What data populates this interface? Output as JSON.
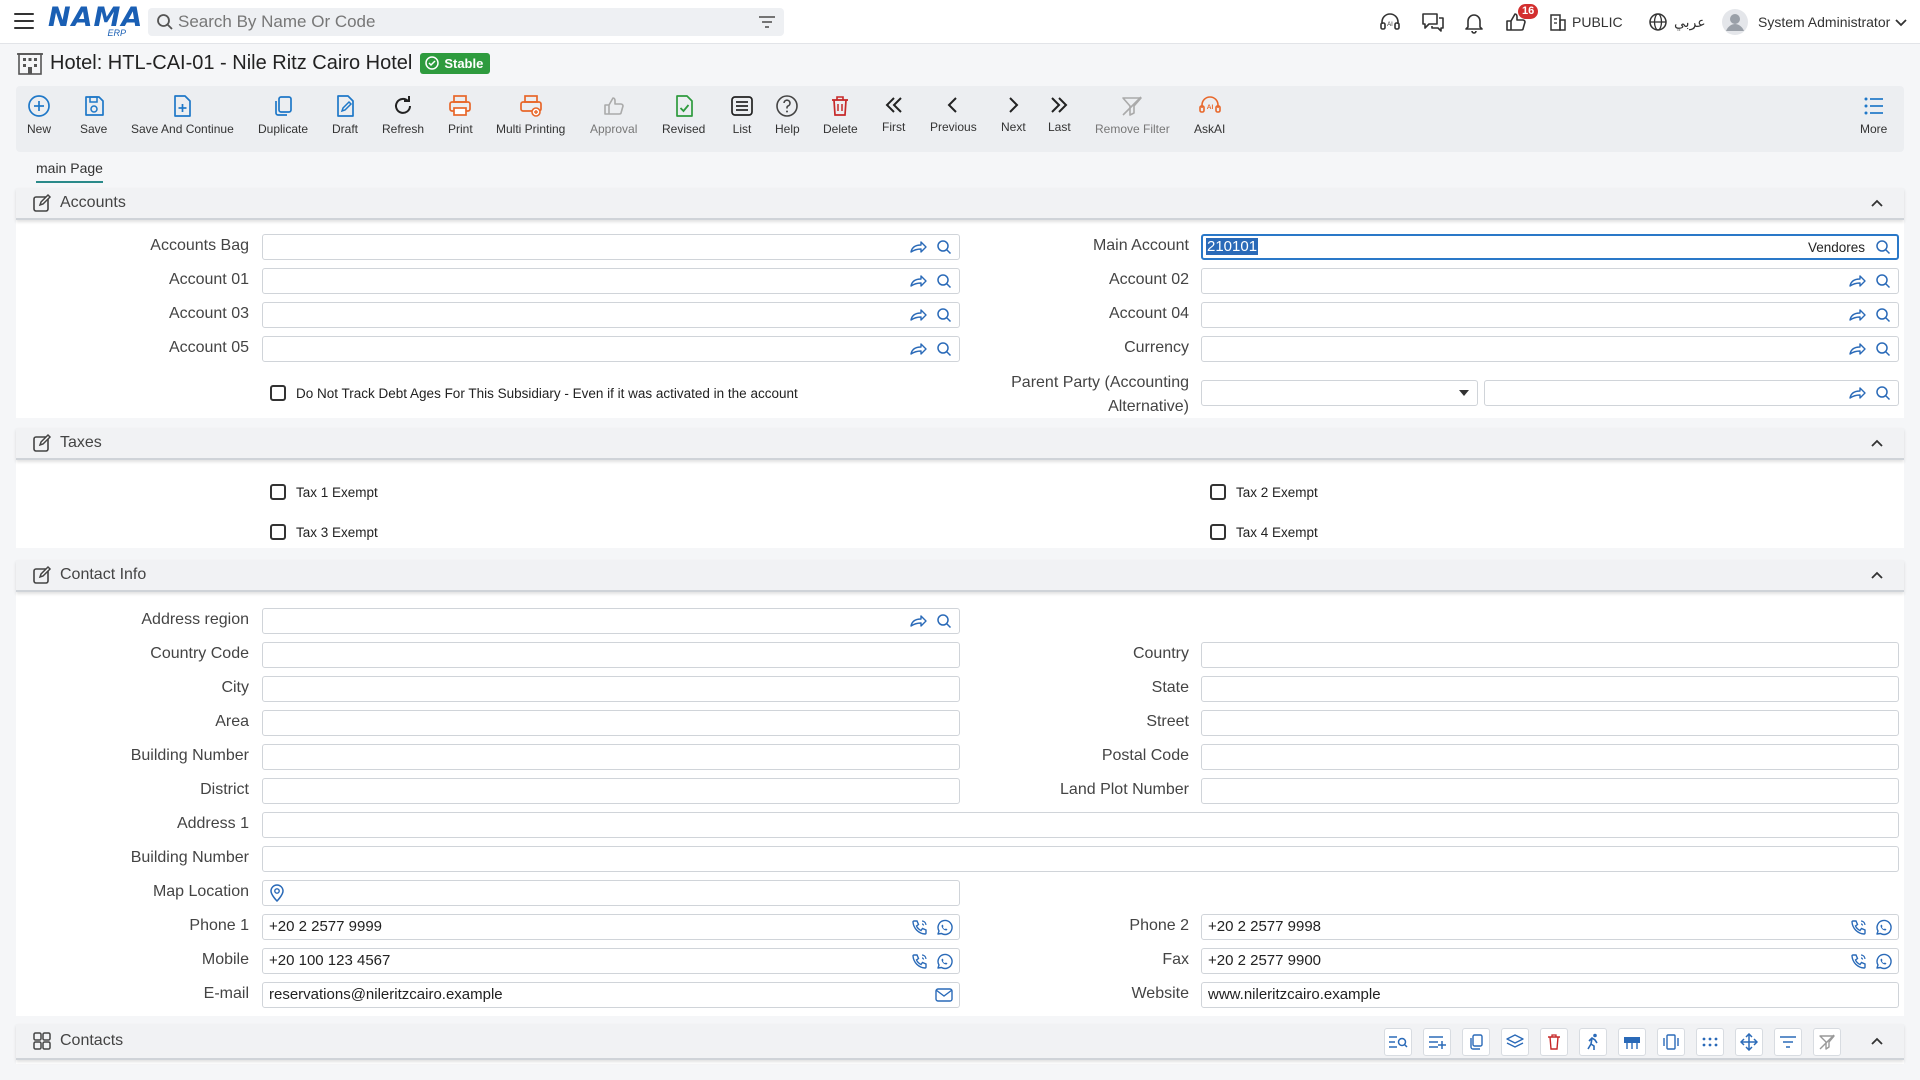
{
  "app": {
    "logo_text": "NAMA",
    "logo_sub": "ERP",
    "search_placeholder": "Search By Name Or Code",
    "notifications_count": "16",
    "public_label": "PUBLIC",
    "language_label": "عربي",
    "user_name": "System Administrator"
  },
  "page": {
    "title": "Hotel: HTL-CAI-01 - Nile Ritz Cairo Hotel",
    "status": "Stable"
  },
  "toolbar": {
    "new": "New",
    "save": "Save",
    "save_continue": "Save And Continue",
    "duplicate": "Duplicate",
    "draft": "Draft",
    "refresh": "Refresh",
    "print": "Print",
    "multi_printing": "Multi Printing",
    "approval": "Approval",
    "revised": "Revised",
    "list": "List",
    "help": "Help",
    "delete": "Delete",
    "first": "First",
    "previous": "Previous",
    "next": "Next",
    "last": "Last",
    "remove_filter": "Remove Filter",
    "askai": "AskAI",
    "more": "More"
  },
  "tabs": {
    "main_page": "main Page"
  },
  "accounts": {
    "title": "Accounts",
    "accounts_bag_label": "Accounts Bag",
    "account01_label": "Account 01",
    "account03_label": "Account 03",
    "account05_label": "Account 05",
    "main_account_label": "Main Account",
    "main_account_value": "210101",
    "main_account_desc": "Vendores",
    "account02_label": "Account 02",
    "account04_label": "Account 04",
    "currency_label": "Currency",
    "parent_party_label_1": "Parent Party (Accounting",
    "parent_party_label_2": "Alternative)",
    "debt_ages_checkbox": "Do Not Track Debt Ages For This Subsidiary - Even if it was activated in the account"
  },
  "taxes": {
    "title": "Taxes",
    "tax1": "Tax 1 Exempt",
    "tax2": "Tax 2 Exempt",
    "tax3": "Tax 3 Exempt",
    "tax4": "Tax 4 Exempt"
  },
  "contact": {
    "title": "Contact Info",
    "address_region_label": "Address region",
    "country_code_label": "Country Code",
    "country_label": "Country",
    "city_label": "City",
    "state_label": "State",
    "area_label": "Area",
    "street_label": "Street",
    "building_number_label": "Building Number",
    "postal_code_label": "Postal Code",
    "district_label": "District",
    "land_plot_label": "Land Plot Number",
    "address1_label": "Address 1",
    "building_number2_label": "Building Number",
    "map_location_label": "Map Location",
    "phone1_label": "Phone 1",
    "phone1_value": "+20 2 2577 9999",
    "phone2_label": "Phone 2",
    "phone2_value": "+20 2 2577 9998",
    "mobile_label": "Mobile",
    "mobile_value": "+20 100 123 4567",
    "fax_label": "Fax",
    "fax_value": "+20 2 2577 9900",
    "email_label": "E-mail",
    "email_value": "reservations@nileritzcairo.example",
    "website_label": "Website",
    "website_value": "www.nileritzcairo.example"
  },
  "contacts": {
    "title": "Contacts"
  },
  "colors": {
    "accent_blue": "#1a5fb4",
    "stable_green": "#2e9b3e",
    "badge_red": "#d32f2f",
    "print_orange": "#e8672a"
  }
}
